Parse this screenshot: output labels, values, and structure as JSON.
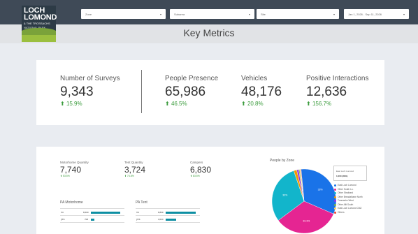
{
  "logo": {
    "line1": "LOCH",
    "line2": "LOMOND",
    "sub": "& THE TROSSACHS",
    "np": "NATIONAL PARK"
  },
  "filters": [
    {
      "label": "Zone"
    },
    {
      "label": "Subarea"
    },
    {
      "label": "Site"
    },
    {
      "label": "Jan 1, 2026 - Sep 11, 2026"
    }
  ],
  "page_title": "Key Metrics",
  "metrics": [
    {
      "label": "Number of Surveys",
      "value": "9,343",
      "change": "15.9%"
    },
    {
      "label": "People Presence",
      "value": "65,986",
      "change": "46.5%"
    },
    {
      "label": "Vehicles",
      "value": "48,176",
      "change": "20.8%"
    },
    {
      "label": "Positive Interactions",
      "value": "12,636",
      "change": "156.7%"
    }
  ],
  "small_metrics": [
    {
      "label": "Motorhome Quantity",
      "value": "7,740",
      "change": "53.5%"
    },
    {
      "label": "Tent Quantity",
      "value": "3,724",
      "change": "74.8%"
    },
    {
      "label": "Campers",
      "value": "6,830",
      "change": "83.5%"
    }
  ],
  "pa_motorhome": {
    "title": "PA Motorhome",
    "rows": [
      {
        "label": "no",
        "value": "8,600"
      },
      {
        "label": "yes",
        "value": "708"
      }
    ]
  },
  "pa_tent": {
    "title": "PA Tent",
    "rows": [
      {
        "label": "no",
        "value": "8,869"
      },
      {
        "label": "yes",
        "value": "3,024"
      }
    ]
  },
  "pie": {
    "title": "People by Zone",
    "tooltip": {
      "zone": "East Loch Lomond",
      "value": "1,000 (29%)"
    },
    "slices": [
      {
        "name": "East Loch Lomond",
        "pct": 33,
        "label": "33%",
        "color": "#1a73e8"
      },
      {
        "name": "Other South Lo.",
        "pct": 33.3,
        "label": "33.3%",
        "color": "#e52592"
      },
      {
        "name": "Other Strathard",
        "pct": 30,
        "label": "30%",
        "color": "#12b5cb"
      },
      {
        "name": "Other Breadalbane North",
        "pct": 1.5,
        "label": "",
        "color": "#f29900"
      },
      {
        "name": "Trossachs West",
        "pct": 1,
        "label": "",
        "color": "#9334e6"
      },
      {
        "name": "Other Allt South",
        "pct": 0.5,
        "label": "",
        "color": "#7cb342"
      },
      {
        "name": "East Loch Lomond CMZ",
        "pct": 0.4,
        "label": "",
        "color": "#fdd663"
      },
      {
        "name": "Others",
        "pct": 0.3,
        "label": "",
        "color": "#ea4335"
      }
    ],
    "legend": [
      {
        "name": "East Loch Lomond",
        "color": "#1a73e8"
      },
      {
        "name": "Other South Lo.",
        "color": "#e52592"
      },
      {
        "name": "Other Strathard",
        "color": "#12b5cb"
      },
      {
        "name": "Other Breadalbane North",
        "color": "#f29900"
      },
      {
        "name": "Trossachs West",
        "color": "#9334e6"
      },
      {
        "name": "Other Allt South",
        "color": "#7cb342"
      },
      {
        "name": "East Loch Lomond CMZ",
        "color": "#fdd663"
      },
      {
        "name": "Others",
        "color": "#ea4335"
      }
    ]
  },
  "icons": {
    "trend": "up-arrow-icon",
    "dropdown": "chevron-down-icon"
  }
}
